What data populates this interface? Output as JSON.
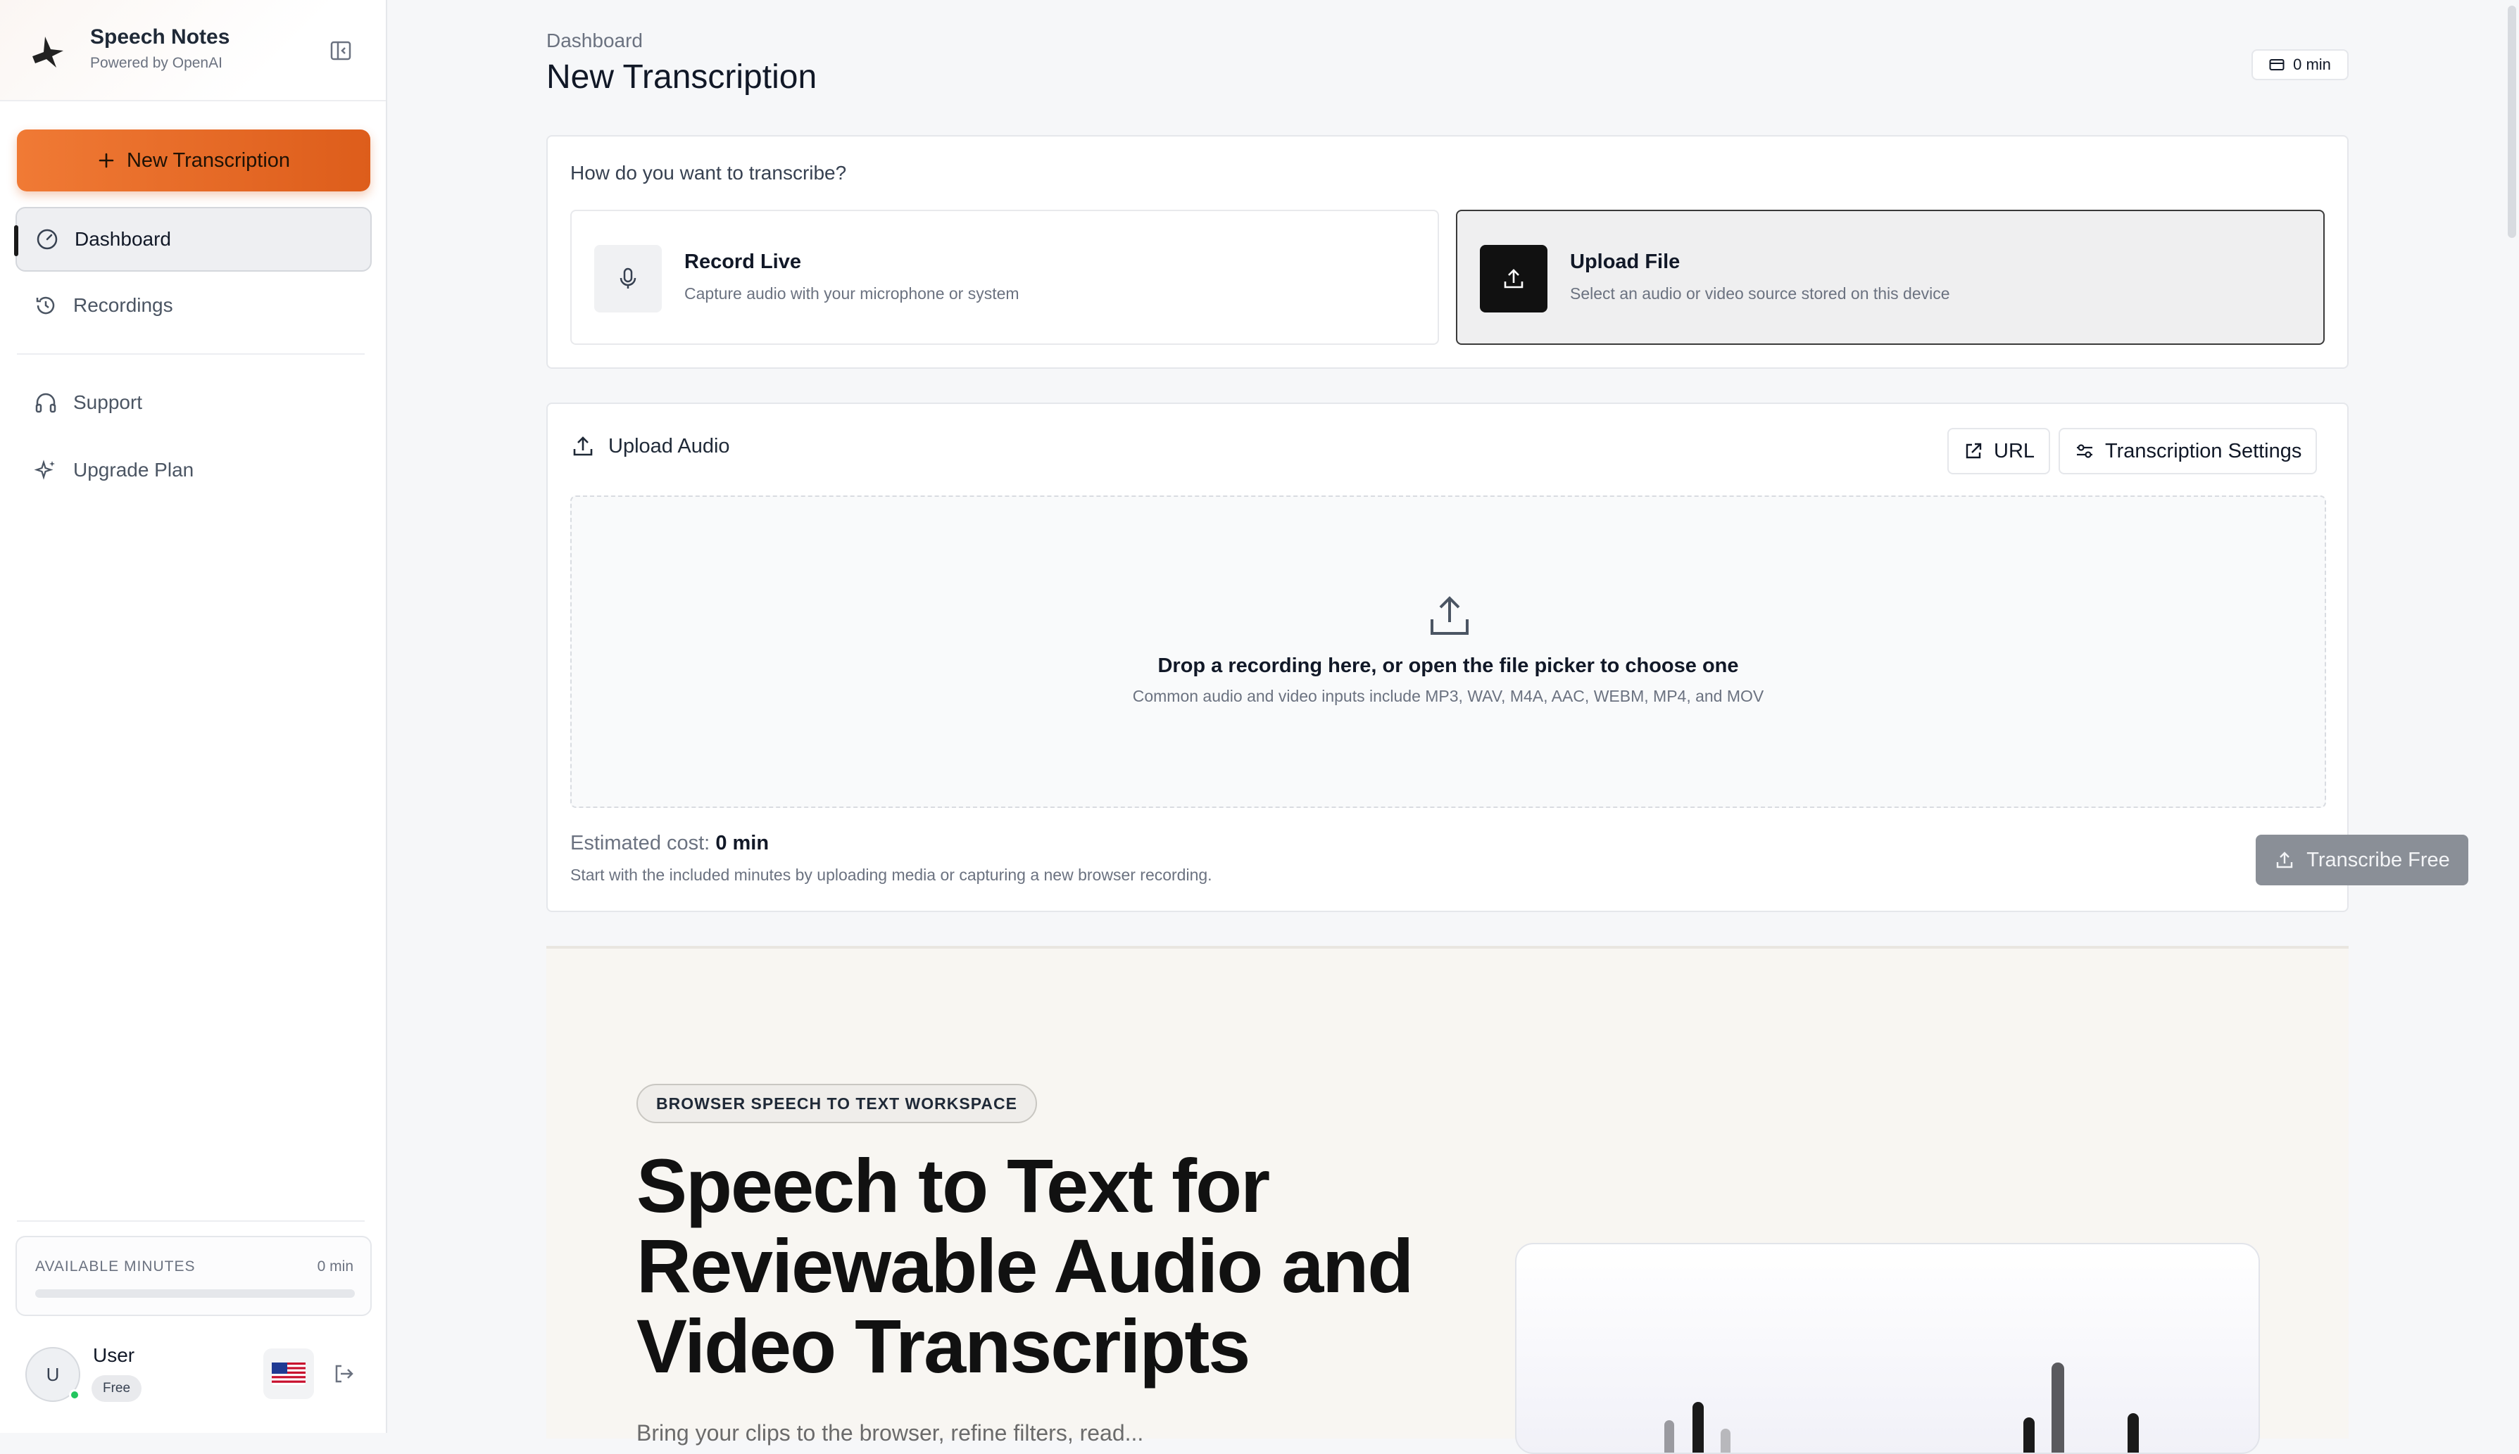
{
  "sidebar": {
    "app_title": "Speech Notes",
    "app_subtitle": "Powered by OpenAI",
    "new_button": "New Transcription",
    "nav": [
      {
        "label": "Dashboard",
        "icon": "gauge-icon",
        "active": true
      },
      {
        "label": "Recordings",
        "icon": "history-icon"
      },
      {
        "label": "Support",
        "icon": "headphones-icon"
      },
      {
        "label": "Upgrade Plan",
        "icon": "sparkles-icon"
      }
    ],
    "minutes": {
      "label": "AVAILABLE MINUTES",
      "value": "0 min",
      "fraction": 0
    },
    "user": {
      "initial": "U",
      "name": "User",
      "plan": "Free",
      "status": "online"
    },
    "language_flag": "us-flag-icon"
  },
  "header": {
    "breadcrumb": "Dashboard",
    "title": "New Transcription",
    "minutes_pill": "0 min"
  },
  "mode": {
    "question": "How do you want to transcribe?",
    "options": [
      {
        "title": "Record Live",
        "desc": "Capture audio with your microphone or system",
        "icon": "microphone-icon",
        "selected": false
      },
      {
        "title": "Upload File",
        "desc": "Select an audio or video source stored on this device",
        "icon": "upload-icon",
        "selected": true
      }
    ]
  },
  "upload": {
    "title": "Upload Audio",
    "url_button": "URL",
    "settings_button": "Transcription Settings",
    "drop_title": "Drop a recording here, or open the file picker to choose one",
    "drop_desc": "Common audio and video inputs include MP3, WAV, M4A, AAC, WEBM, MP4, and MOV",
    "estimated_label": "Estimated cost:",
    "estimated_value": "0 min",
    "estimated_desc": "Start with the included minutes by uploading media or capturing a new browser recording.",
    "transcribe_button": "Transcribe Free"
  },
  "hero": {
    "badge": "BROWSER SPEECH TO TEXT WORKSPACE",
    "title_lines": [
      "Speech to Text for",
      "Reviewable Audio and",
      "Video Transcripts"
    ],
    "subtitle": "Bring your clips to the browser, refine filters, read..."
  },
  "colors": {
    "accent": "#e8692a",
    "selected_border": "#3a3a3a",
    "disabled_button": "#8a8f97",
    "online": "#22c55e"
  }
}
